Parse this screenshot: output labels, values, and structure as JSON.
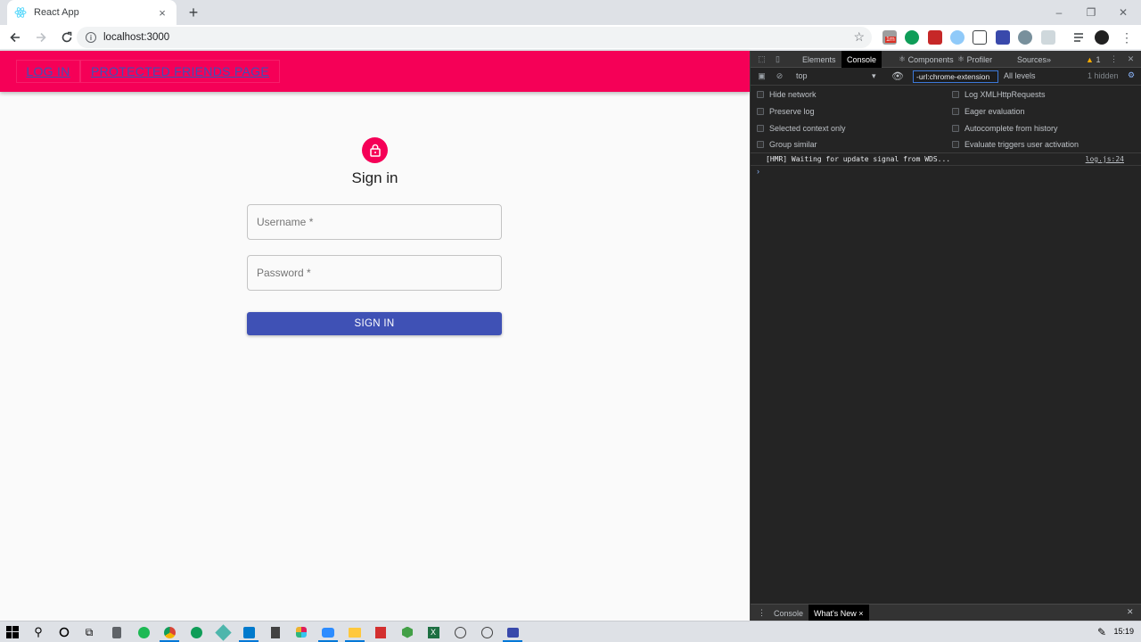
{
  "browser": {
    "tab_title": "React App",
    "tab_close": "×",
    "new_tab": "+",
    "url": "localhost:3000",
    "window_controls": {
      "minimize": "–",
      "restore": "❐",
      "close": "✕"
    },
    "extension_badge": "1m"
  },
  "app": {
    "nav_links": [
      "LOG IN",
      "PROTECTED FRIENDS PAGE"
    ],
    "accent_color": "#f50057",
    "primary_color": "#3f51b5",
    "form": {
      "title": "Sign in",
      "username_label": "Username *",
      "password_label": "Password *",
      "submit_label": "SIGN IN"
    }
  },
  "devtools": {
    "tabs": [
      "Elements",
      "Console",
      "Components",
      "Profiler",
      "Sources"
    ],
    "active_tab": "Console",
    "more_tabs": "»",
    "warning_count": "1",
    "context": "top",
    "filter_value": "-url:chrome-extension",
    "levels": "All levels",
    "hidden_count": "1 hidden",
    "settings_left": [
      "Hide network",
      "Preserve log",
      "Selected context only",
      "Group similar"
    ],
    "settings_right": [
      "Log XMLHttpRequests",
      "Eager evaluation",
      "Autocomplete from history",
      "Evaluate triggers user activation"
    ],
    "message": "[HMR] Waiting for update signal from WDS...",
    "message_source": "log.js:24",
    "prompt": "›",
    "drawer_tabs": [
      "Console",
      "What's New"
    ],
    "drawer_close": "×"
  },
  "taskbar": {
    "time": "15:19"
  }
}
